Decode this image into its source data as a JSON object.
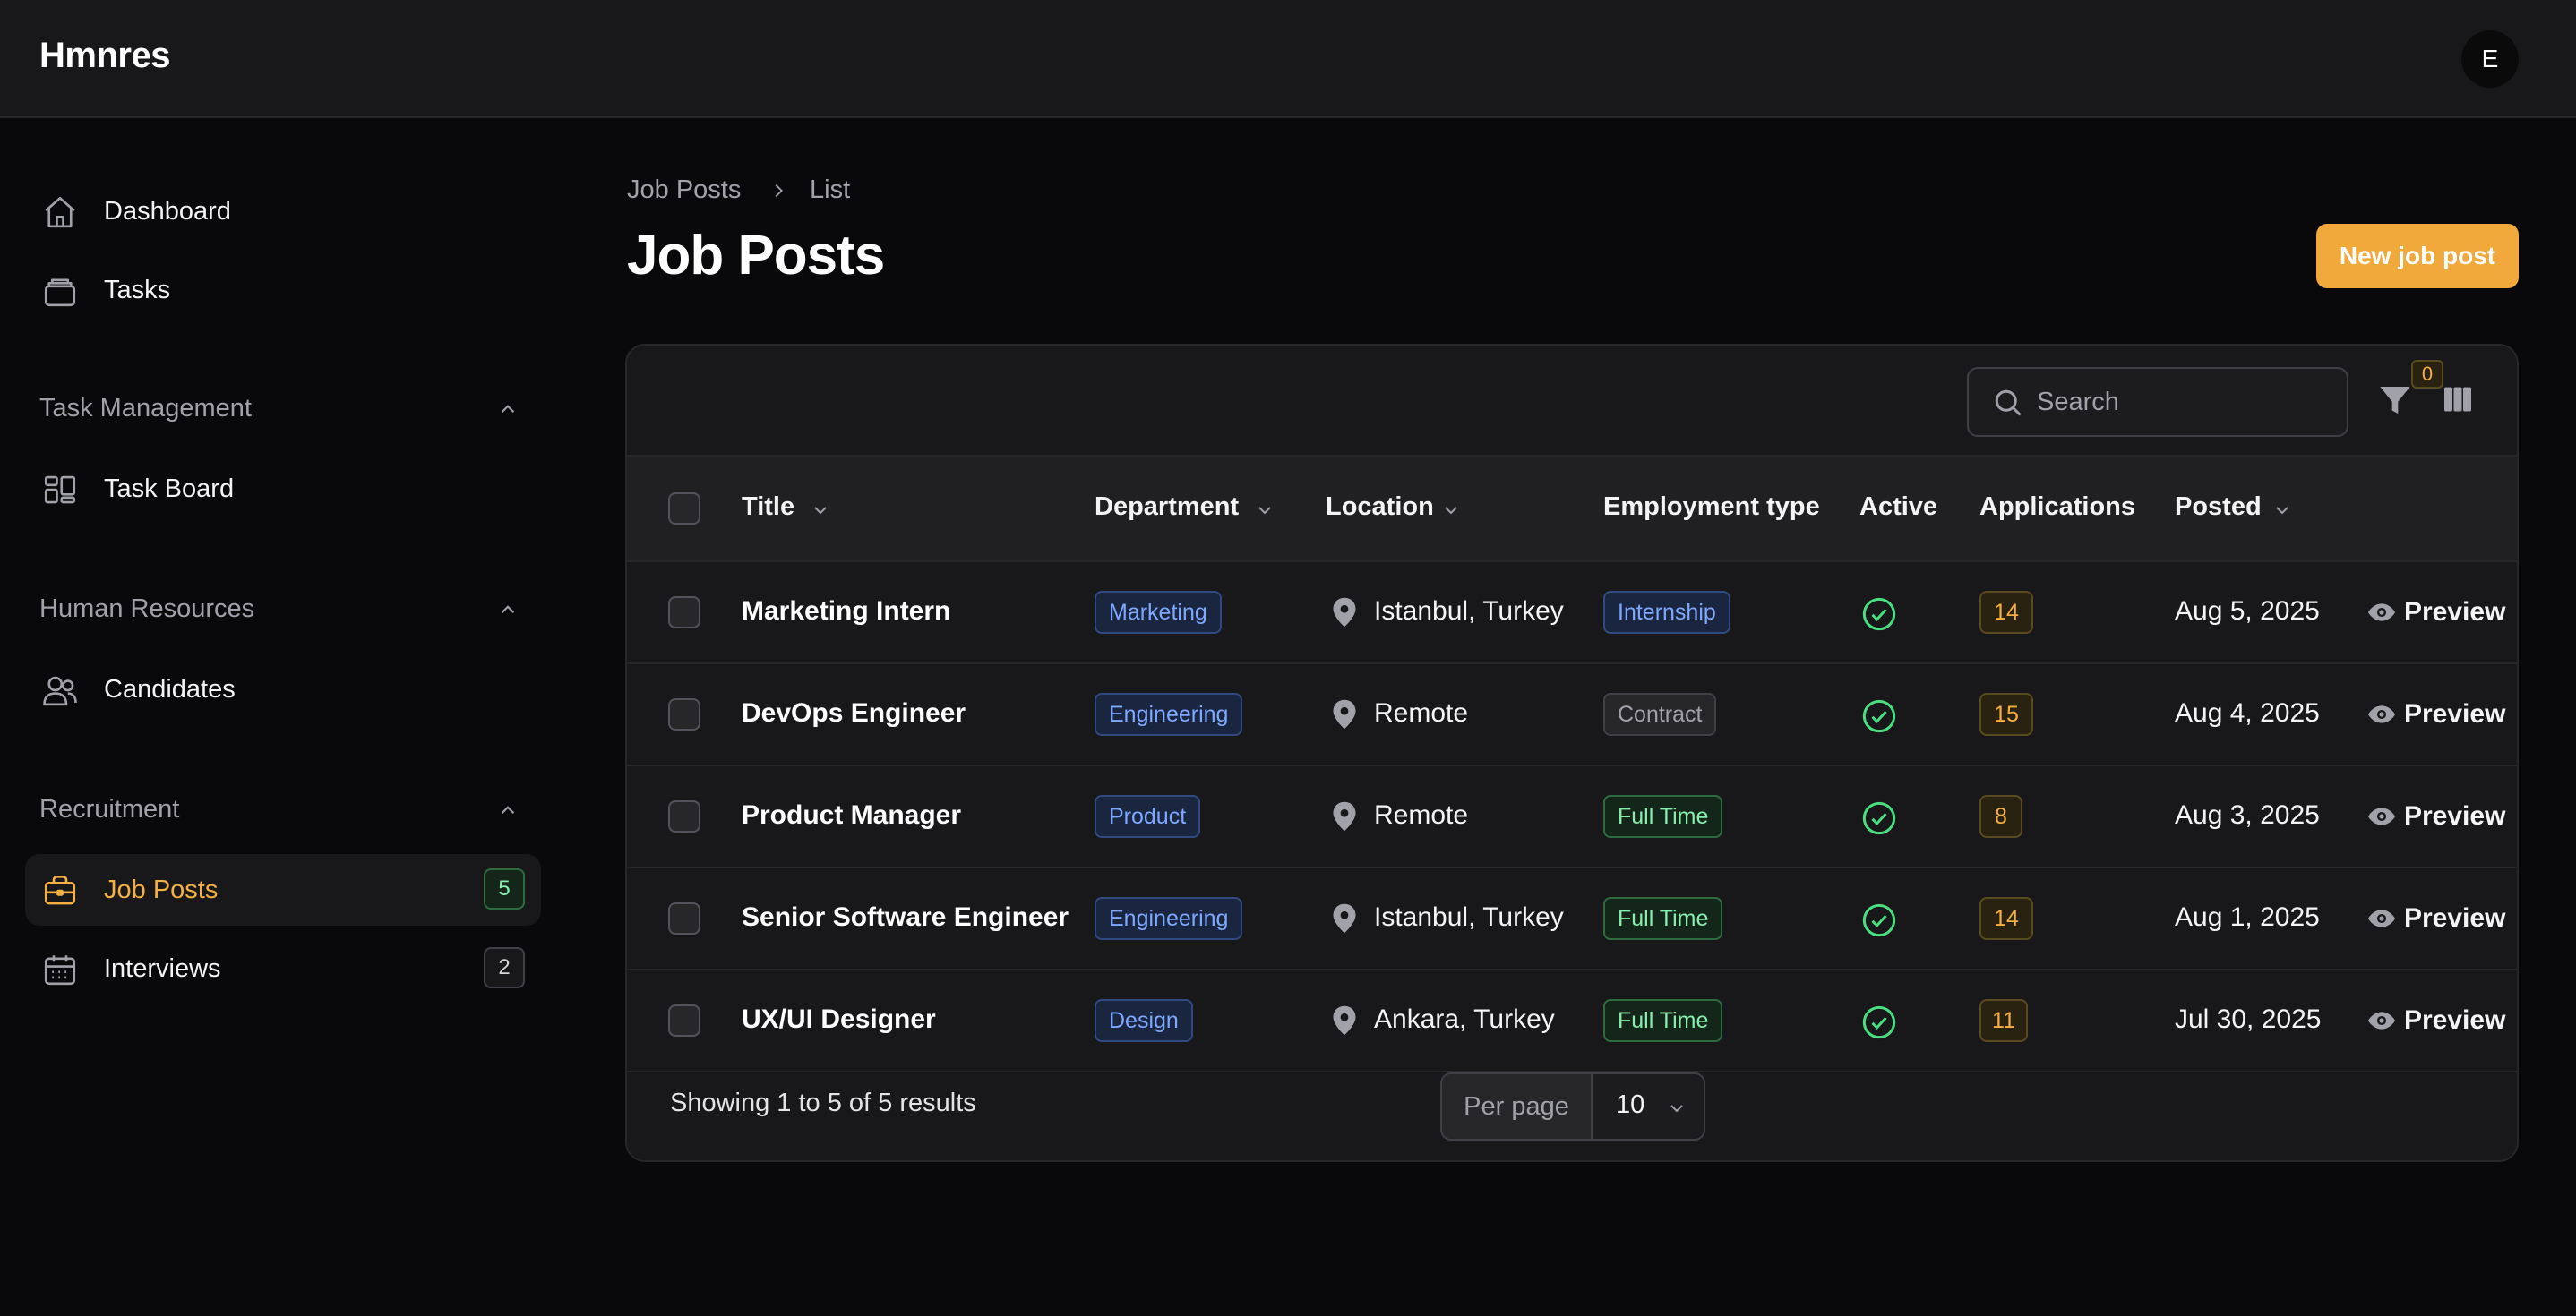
{
  "app": {
    "brand": "Hmnres",
    "avatar_initial": "E"
  },
  "sidebar": {
    "top_items": [
      {
        "label": "Dashboard",
        "icon": "home-icon"
      },
      {
        "label": "Tasks",
        "icon": "tasks-icon"
      }
    ],
    "groups": [
      {
        "label": "Task Management",
        "items": [
          {
            "label": "Task Board",
            "icon": "board-icon"
          }
        ]
      },
      {
        "label": "Human Resources",
        "items": [
          {
            "label": "Candidates",
            "icon": "users-icon"
          }
        ]
      },
      {
        "label": "Recruitment",
        "items": [
          {
            "label": "Job Posts",
            "icon": "briefcase-icon",
            "badge": "5",
            "active": true
          },
          {
            "label": "Interviews",
            "icon": "calendar-icon",
            "badge": "2"
          }
        ]
      }
    ]
  },
  "breadcrumb": {
    "parent": "Job Posts",
    "current": "List"
  },
  "page": {
    "title": "Job Posts",
    "new_button": "New job post"
  },
  "toolbar": {
    "search_placeholder": "Search",
    "filter_count": "0"
  },
  "table": {
    "columns": [
      "Title",
      "Department",
      "Location",
      "Employment type",
      "Active",
      "Applications",
      "Posted"
    ],
    "rows": [
      {
        "title": "Marketing Intern",
        "department": "Marketing",
        "location": "Istanbul, Turkey",
        "employment": "Internship",
        "employment_style": "blue",
        "active": true,
        "applications": "14",
        "posted": "Aug 5, 2025",
        "action": "Preview"
      },
      {
        "title": "DevOps Engineer",
        "department": "Engineering",
        "location": "Remote",
        "employment": "Contract",
        "employment_style": "gray",
        "active": true,
        "applications": "15",
        "posted": "Aug 4, 2025",
        "action": "Preview"
      },
      {
        "title": "Product Manager",
        "department": "Product",
        "location": "Remote",
        "employment": "Full Time",
        "employment_style": "green",
        "active": true,
        "applications": "8",
        "posted": "Aug 3, 2025",
        "action": "Preview"
      },
      {
        "title": "Senior Software Engineer",
        "department": "Engineering",
        "location": "Istanbul, Turkey",
        "employment": "Full Time",
        "employment_style": "green",
        "active": true,
        "applications": "14",
        "posted": "Aug 1, 2025",
        "action": "Preview"
      },
      {
        "title": "UX/UI Designer",
        "department": "Design",
        "location": "Ankara, Turkey",
        "employment": "Full Time",
        "employment_style": "green",
        "active": true,
        "applications": "11",
        "posted": "Jul 30, 2025",
        "action": "Preview"
      }
    ]
  },
  "footer": {
    "results_text": "Showing 1 to 5 of 5 results",
    "per_page_label": "Per page",
    "per_page_value": "10"
  },
  "colors": {
    "accent": "#f0a93a",
    "background": "#09090b",
    "surface": "#18181b"
  }
}
